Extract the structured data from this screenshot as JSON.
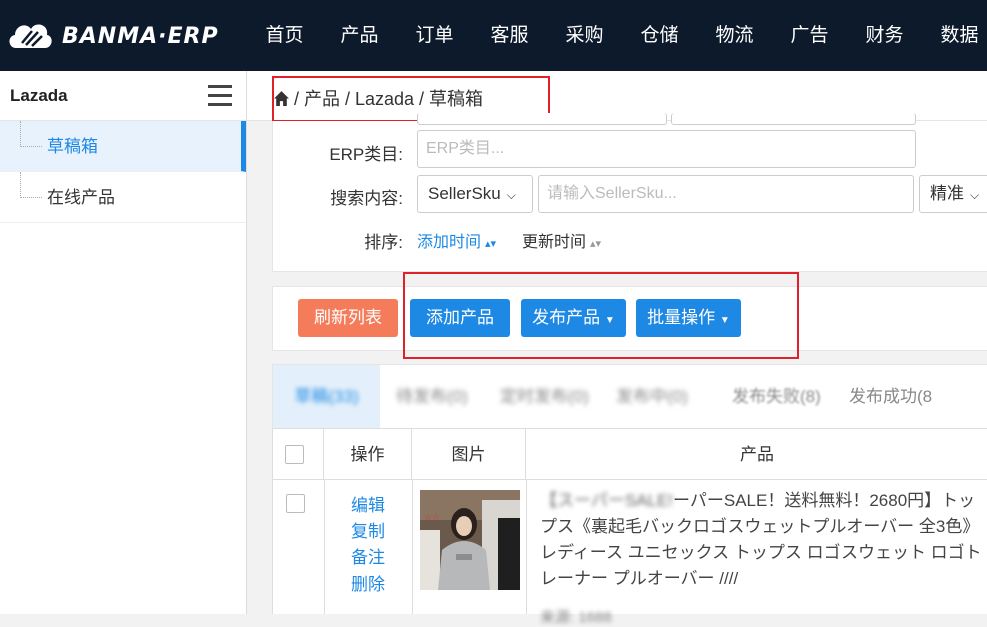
{
  "app": {
    "logo_text": "BANMA·ERP"
  },
  "nav": {
    "items": [
      "首页",
      "产品",
      "订单",
      "客服",
      "采购",
      "仓储",
      "物流",
      "广告",
      "财务",
      "数据"
    ]
  },
  "sidebar": {
    "title": "Lazada",
    "items": [
      {
        "label": "草稿箱",
        "active": true
      },
      {
        "label": "在线产品",
        "active": false
      }
    ]
  },
  "breadcrumb": {
    "path": "/ 产品 / Lazada / 草稿箱"
  },
  "filter": {
    "erp_category_label": "ERP类目:",
    "erp_category_placeholder": "ERP类目...",
    "search_label": "搜索内容:",
    "search_field": "SellerSku",
    "search_placeholder": "请输入SellerSku...",
    "match_mode": "精准",
    "sort_label": "排序:",
    "sort_options": [
      "添加时间",
      "更新时间"
    ]
  },
  "actions": {
    "refresh": "刷新列表",
    "add_product": "添加产品",
    "publish_product": "发布产品",
    "batch_operation": "批量操作"
  },
  "tabs": [
    {
      "label": "草稿(33)",
      "state": "active-blurred"
    },
    {
      "label": "待发布(0)",
      "state": "blurred"
    },
    {
      "label": "定时发布(0)",
      "state": "blurred"
    },
    {
      "label": "发布中(0)",
      "state": "blurred"
    },
    {
      "label": "发布失败(8)",
      "state": "partial"
    },
    {
      "label": "发布成功(8",
      "state": "normal"
    }
  ],
  "table": {
    "headers": {
      "operation": "操作",
      "image": "图片",
      "product": "产品"
    },
    "row": {
      "ops": [
        "编辑",
        "复制",
        "备注",
        "删除"
      ],
      "title_blurred_prefix": "【スーパーSALE!",
      "title": "ーパーSALE！送料無料！2680円】トップス《裏起毛バックロゴスウェットプルオーバー 全3色》 レディース ユニセックス トップス ロゴスウェット ロゴトレーナー プルオーバー ////",
      "sub": "来源: 1688"
    }
  },
  "colors": {
    "nav_bg": "#0d1a2c",
    "accent": "#1e88e5",
    "refresh_btn": "#f47c5a",
    "highlight_box": "#e0202a"
  }
}
